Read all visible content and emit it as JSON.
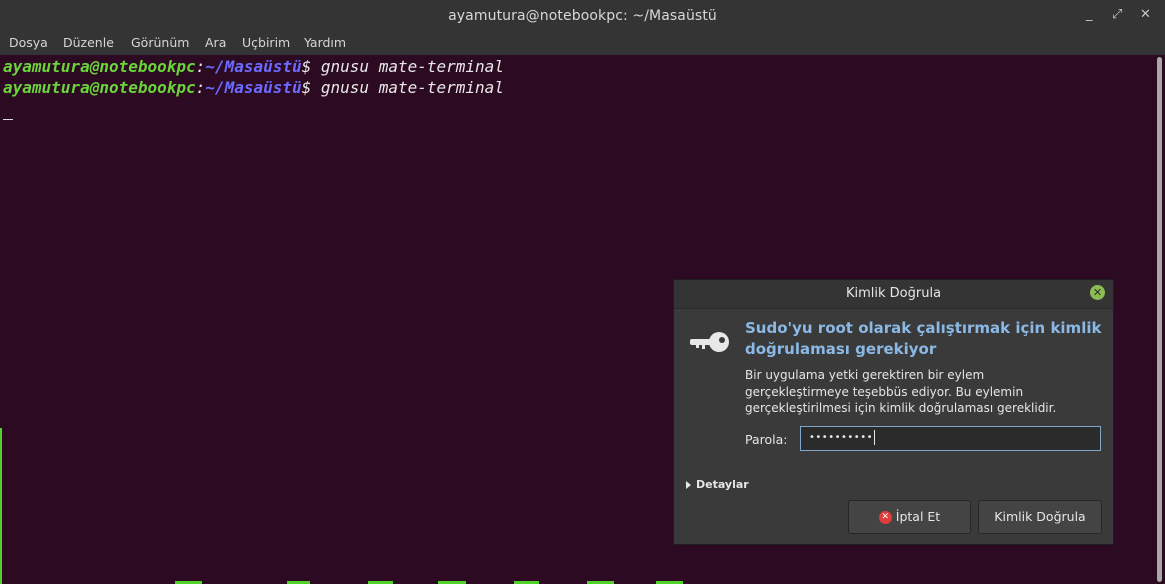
{
  "window": {
    "title": "ayamutura@notebookpc: ~/Masaüstü",
    "minimize": "_",
    "maximize": "⤢",
    "close": "✕"
  },
  "menu": [
    "Dosya",
    "Düzenle",
    "Görünüm",
    "Ara",
    "Uçbirim",
    "Yardım"
  ],
  "terminal": {
    "lines": [
      {
        "user": "ayamutura@notebookpc",
        "sep": ":",
        "path": "~/Masaüstü",
        "prompt": "$ ",
        "command": "gnusu mate-terminal"
      },
      {
        "user": "ayamutura@notebookpc",
        "sep": ":",
        "path": "~/Masaüstü",
        "prompt": "$ ",
        "command": "gnusu mate-terminal"
      }
    ]
  },
  "dialog": {
    "title": "Kimlik Doğrula",
    "heading": "Sudo'yu root olarak çalıştırmak için kimlik doğrulaması gerekiyor",
    "body": "Bir uygulama yetki gerektiren bir eylem gerçekleştirmeye teşebbüs ediyor. Bu eylemin gerçekleştirilmesi için kimlik doğrulaması gereklidir.",
    "password_label": "Parola:",
    "password_value": "••••••••••",
    "details_label": "Detaylar",
    "cancel_label": "İptal Et",
    "authenticate_label": "Kimlik Doğrula",
    "close_glyph": "✕"
  },
  "colors": {
    "terminal_bg": "#2c0a22",
    "user": "#6ad53a",
    "path": "#6b6bff",
    "heading": "#8bb9e6"
  }
}
